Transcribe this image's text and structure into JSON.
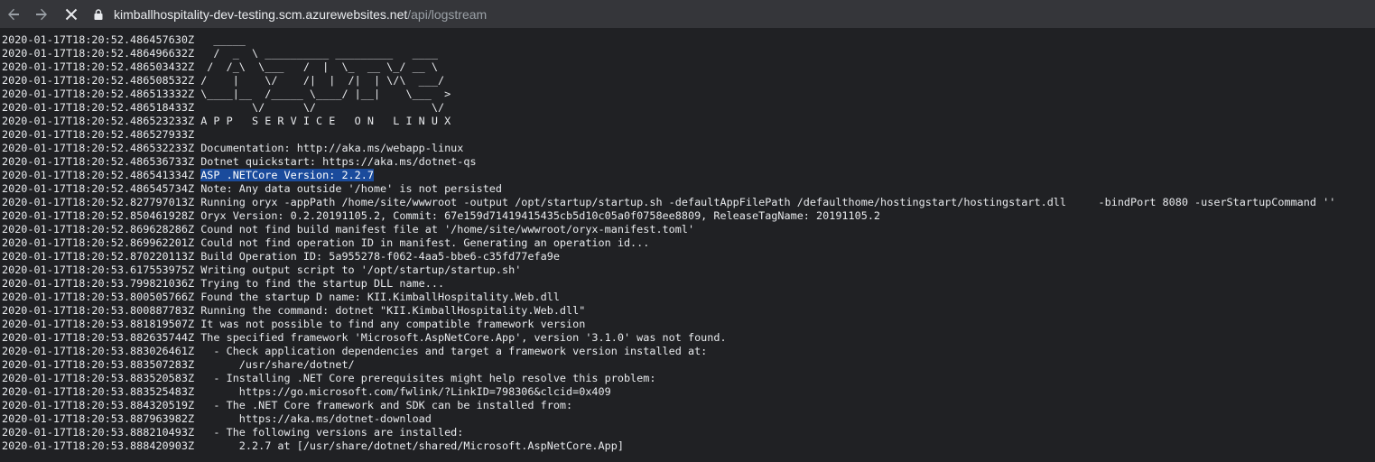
{
  "browser": {
    "back_icon": "arrow-left-icon",
    "forward_icon": "arrow-right-icon",
    "stop_icon": "close-icon",
    "lock_icon": "lock-icon",
    "url_host": "kimballhospitality-dev-testing.scm.azurewebsites.net",
    "url_path": "/api/logstream"
  },
  "log": {
    "selected_line_index": 12,
    "lines": [
      {
        "ts": "2020-01-17T18:20:52.486457630Z",
        "msg": "  _____"
      },
      {
        "ts": "2020-01-17T18:20:52.486496632Z",
        "msg": "  /  _  \\ __________ _________   ____"
      },
      {
        "ts": "2020-01-17T18:20:52.486503432Z",
        "msg": " /  /_\\  \\___   /  |  \\_  __ \\_/ __ \\"
      },
      {
        "ts": "2020-01-17T18:20:52.486508532Z",
        "msg": "/    |    \\/    /|  |  /|  | \\/\\  ___/"
      },
      {
        "ts": "2020-01-17T18:20:52.486513332Z",
        "msg": "\\____|__  /_____ \\____/ |__|    \\___  >"
      },
      {
        "ts": "2020-01-17T18:20:52.486518433Z",
        "msg": "        \\/      \\/                  \\/"
      },
      {
        "ts": "2020-01-17T18:20:52.486523233Z",
        "msg": "A P P   S E R V I C E   O N   L I N U X"
      },
      {
        "ts": "2020-01-17T18:20:52.486527933Z",
        "msg": ""
      },
      {
        "ts": "2020-01-17T18:20:52.486532233Z",
        "msg": "Documentation: http://aka.ms/webapp-linux"
      },
      {
        "ts": "2020-01-17T18:20:52.486536733Z",
        "msg": "Dotnet quickstart: https://aka.ms/dotnet-qs"
      },
      {
        "ts": "2020-01-17T18:20:52.486541334Z",
        "msg": "ASP .NETCore Version: 2.2.7"
      },
      {
        "ts": "2020-01-17T18:20:52.486545734Z",
        "msg": "Note: Any data outside '/home' is not persisted"
      },
      {
        "ts": "2020-01-17T18:20:52.827797013Z",
        "msg": "Running oryx -appPath /home/site/wwwroot -output /opt/startup/startup.sh -defaultAppFilePath /defaulthome/hostingstart/hostingstart.dll     -bindPort 8080 -userStartupCommand ''"
      },
      {
        "ts": "2020-01-17T18:20:52.850461928Z",
        "msg": "Oryx Version: 0.2.20191105.2, Commit: 67e159d71419415435cb5d10c05a0f0758ee8809, ReleaseTagName: 20191105.2"
      },
      {
        "ts": "2020-01-17T18:20:52.869628286Z",
        "msg": "Cound not find build manifest file at '/home/site/wwwroot/oryx-manifest.toml'"
      },
      {
        "ts": "2020-01-17T18:20:52.869962201Z",
        "msg": "Could not find operation ID in manifest. Generating an operation id..."
      },
      {
        "ts": "2020-01-17T18:20:52.870220113Z",
        "msg": "Build Operation ID: 5a955278-f062-4aa5-bbe6-c35fd77efa9e"
      },
      {
        "ts": "2020-01-17T18:20:53.617553975Z",
        "msg": "Writing output script to '/opt/startup/startup.sh'"
      },
      {
        "ts": "2020-01-17T18:20:53.799821036Z",
        "msg": "Trying to find the startup DLL name..."
      },
      {
        "ts": "2020-01-17T18:20:53.800505766Z",
        "msg": "Found the startup D name: KII.KimballHospitality.Web.dll"
      },
      {
        "ts": "2020-01-17T18:20:53.800887783Z",
        "msg": "Running the command: dotnet \"KII.KimballHospitality.Web.dll\""
      },
      {
        "ts": "2020-01-17T18:20:53.881819507Z",
        "msg": "It was not possible to find any compatible framework version"
      },
      {
        "ts": "2020-01-17T18:20:53.882635744Z",
        "msg": "The specified framework 'Microsoft.AspNetCore.App', version '3.1.0' was not found."
      },
      {
        "ts": "2020-01-17T18:20:53.883026461Z",
        "msg": "  - Check application dependencies and target a framework version installed at:"
      },
      {
        "ts": "2020-01-17T18:20:53.883507283Z",
        "msg": "      /usr/share/dotnet/"
      },
      {
        "ts": "2020-01-17T18:20:53.883520583Z",
        "msg": "  - Installing .NET Core prerequisites might help resolve this problem:"
      },
      {
        "ts": "2020-01-17T18:20:53.883525483Z",
        "msg": "      https://go.microsoft.com/fwlink/?LinkID=798306&clcid=0x409"
      },
      {
        "ts": "2020-01-17T18:20:53.884320519Z",
        "msg": "  - The .NET Core framework and SDK can be installed from:"
      },
      {
        "ts": "2020-01-17T18:20:53.887963982Z",
        "msg": "      https://aka.ms/dotnet-download"
      },
      {
        "ts": "2020-01-17T18:20:53.888210493Z",
        "msg": "  - The following versions are installed:"
      },
      {
        "ts": "2020-01-17T18:20:53.888420903Z",
        "msg": "      2.2.7 at [/usr/share/dotnet/shared/Microsoft.AspNetCore.App]"
      }
    ]
  }
}
